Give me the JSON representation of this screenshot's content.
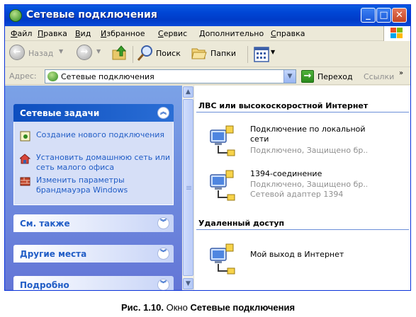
{
  "window": {
    "title": "Сетевые подключения",
    "icon": "network-folder-icon"
  },
  "menu": {
    "items": [
      {
        "u": "Ф",
        "rest": "айл"
      },
      {
        "u": "П",
        "rest": "равка"
      },
      {
        "u": "В",
        "rest": "ид"
      },
      {
        "u": "И",
        "rest": "збранное"
      },
      {
        "u": "С",
        "rest": "ервис"
      },
      {
        "u": "Д",
        "rest": "ополнительно"
      },
      {
        "u": "С",
        "rest": "правка"
      }
    ]
  },
  "toolbar": {
    "back_label": "Назад",
    "search_label": "Поиск",
    "folders_label": "Папки"
  },
  "address": {
    "label": "Адрес:",
    "value": "Сетевые подключения",
    "go_label": "Переход",
    "links_label": "Ссылки"
  },
  "taskpane": {
    "network_tasks": {
      "title": "Сетевые задачи",
      "items": [
        "Создание нового подключения",
        "Установить домашнюю сеть или сеть малого офиса",
        "Изменить параметры брандмауэра Windows"
      ]
    },
    "see_also": "См. также",
    "other_places": "Другие места",
    "details": "Подробно"
  },
  "main": {
    "groups": [
      {
        "title": "ЛВС или высокоскоростной Интернет",
        "items": [
          {
            "name": "Подключение по локальной сети",
            "status": "Подключено, Защищено бр..."
          },
          {
            "name": "1394-соединение",
            "status1": "Подключено, Защищено бр...",
            "status2": "Сетевой адаптер 1394"
          }
        ]
      },
      {
        "title": "Удаленный доступ",
        "items": [
          {
            "name": "Мой выход в Интернет"
          }
        ]
      }
    ]
  },
  "caption": {
    "prefix": "Рис. 1.10.",
    "middle": " Окно ",
    "bold": "Сетевые подключения"
  },
  "colors": {
    "titlebar": "#0046d5",
    "taskpane": "#6375d6",
    "link": "#215dc6"
  }
}
